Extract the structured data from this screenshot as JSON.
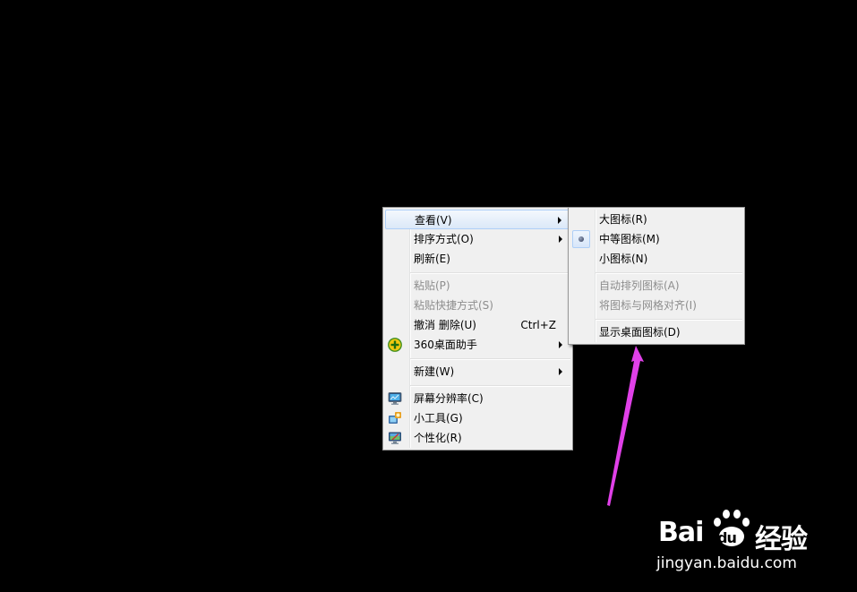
{
  "context_menu": {
    "items": [
      {
        "label": "查看(V)",
        "submenu": true
      },
      {
        "label": "排序方式(O)",
        "submenu": true
      },
      {
        "label": "刷新(E)"
      },
      {
        "label": "粘贴(P)",
        "disabled": true
      },
      {
        "label": "粘贴快捷方式(S)",
        "disabled": true
      },
      {
        "label": "撤消 删除(U)",
        "shortcut": "Ctrl+Z"
      },
      {
        "label": "360桌面助手",
        "submenu": true,
        "icon": "360-plus-icon"
      },
      {
        "label": "新建(W)",
        "submenu": true
      },
      {
        "label": "屏幕分辨率(C)",
        "icon": "monitor-icon"
      },
      {
        "label": "小工具(G)",
        "icon": "gadgets-icon"
      },
      {
        "label": "个性化(R)",
        "icon": "personalize-icon"
      }
    ]
  },
  "view_submenu": {
    "items": [
      {
        "label": "大图标(R)"
      },
      {
        "label": "中等图标(M)",
        "selected": true
      },
      {
        "label": "小图标(N)"
      },
      {
        "label": "自动排列图标(A)",
        "disabled": true
      },
      {
        "label": "将图标与网格对齐(I)",
        "disabled": true
      },
      {
        "label": "显示桌面图标(D)"
      }
    ]
  },
  "watermark": {
    "brand_left": "Bai",
    "brand_paw": "du",
    "brand_right": "经验",
    "url": "jingyan.baidu.com"
  },
  "colors": {
    "desktop": "#000000",
    "menu_bg": "#f0f0f0",
    "highlight_border": "#aecff7",
    "annotation_arrow": "#e040e8"
  }
}
